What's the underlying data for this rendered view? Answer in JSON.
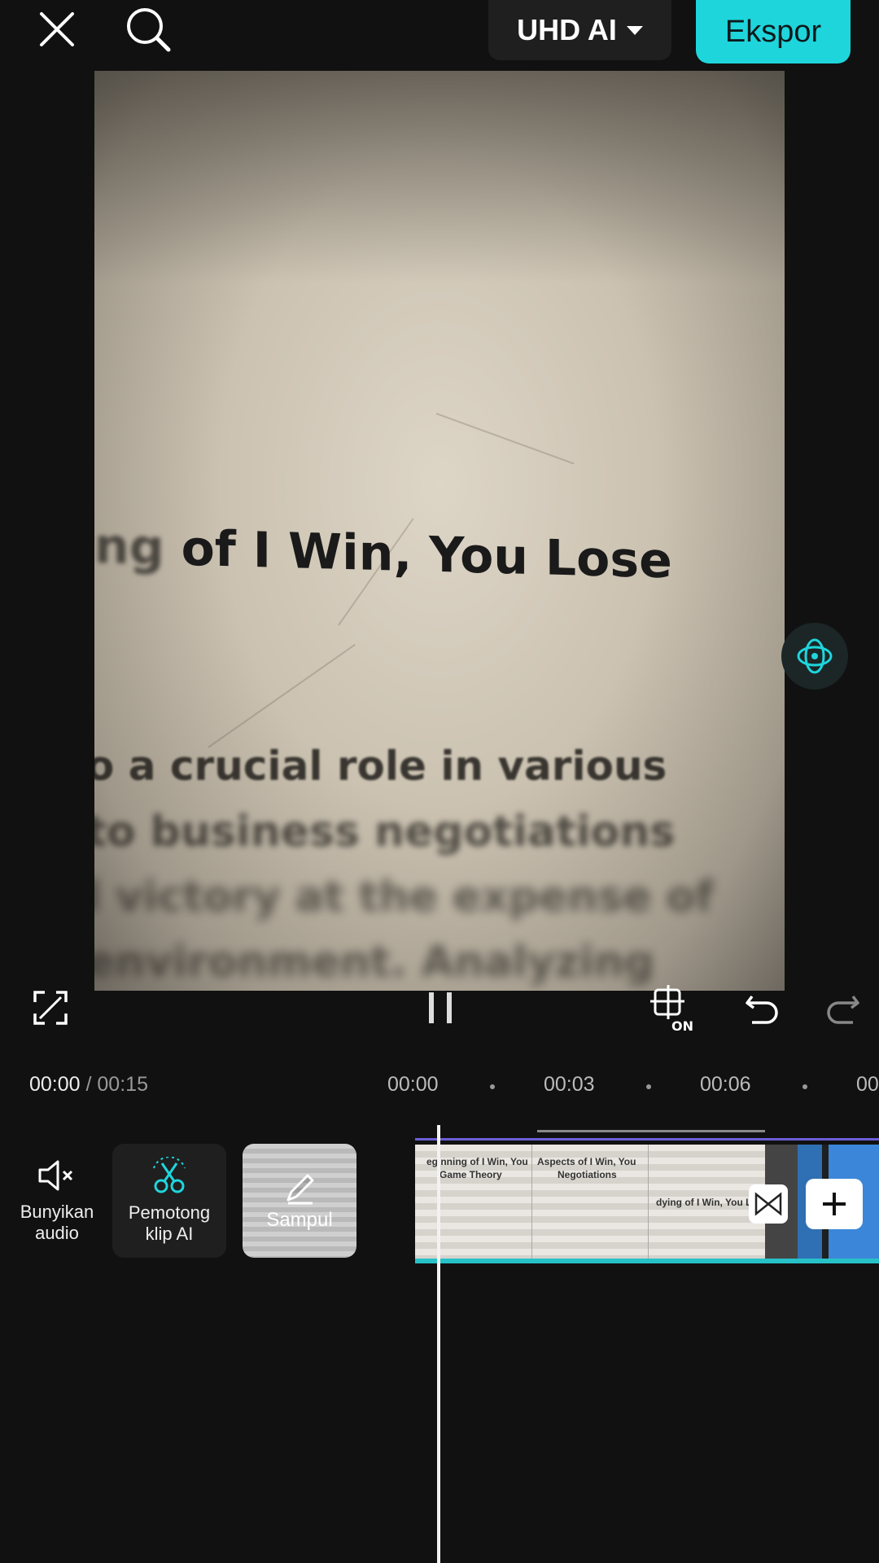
{
  "topbar": {
    "close_icon": "close-icon",
    "search_icon": "search-icon",
    "quality_label": "UHD AI",
    "export_label": "Ekspor"
  },
  "preview": {
    "headline_faded": "ng",
    "headline_main": "of  I Win, You Lose",
    "line1": "o a crucial role in various",
    "line2": "to business negotiations",
    "line3": "l victory at the expense of",
    "line4": "environment. Analyzing"
  },
  "controls": {
    "fullscreen_icon": "fullscreen-icon",
    "pause_icon": "pause-icon",
    "keyframe_on_icon": "keyframe-on-icon",
    "keyframe_on_text": "ON",
    "undo_icon": "undo-icon",
    "redo_icon": "redo-icon"
  },
  "time": {
    "current": "00:00",
    "total": "/ 00:15",
    "ruler": [
      "00:00",
      "00:03",
      "00:06",
      "00"
    ]
  },
  "tools": {
    "audio_label": "Bunyikan audio",
    "cut_label": "Pemotong klip AI",
    "cover_label": "Sampul"
  },
  "clip": {
    "frame1_title": "eginning of I Win, You",
    "frame1_sub": "Game Theory",
    "frame2_title": "Aspects of I Win, You",
    "frame2_sub": "Negotiations",
    "frame3_title": "dying of I Win, You Lose"
  },
  "colors": {
    "accent": "#1fd5dc",
    "track_purple": "#6c5ed6",
    "background": "#111111"
  }
}
